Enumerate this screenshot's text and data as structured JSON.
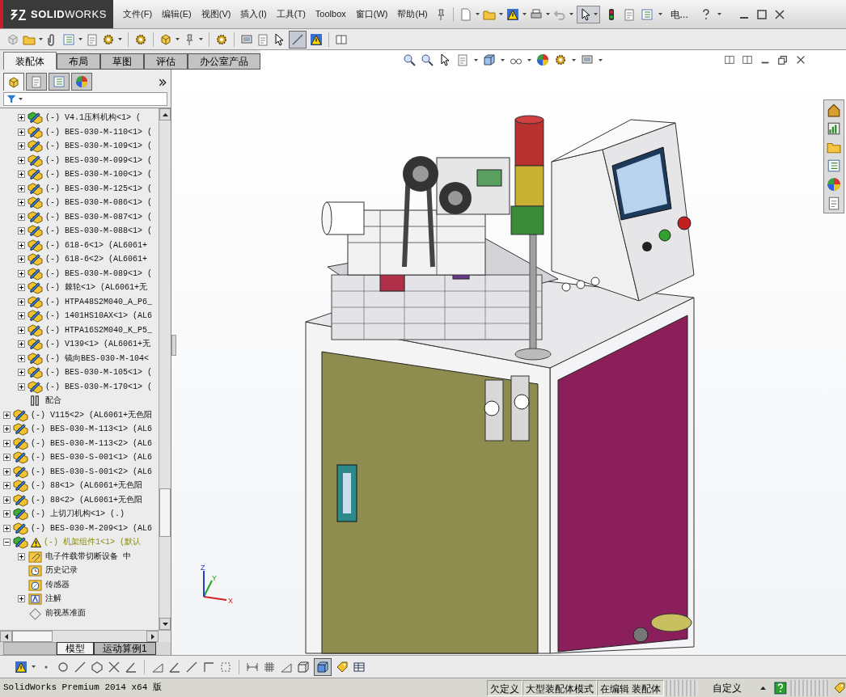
{
  "title_bar": {
    "logo": "**SOLID**WORKS",
    "menu": [
      "文件(F)",
      "编辑(E)",
      "视图(V)",
      "插入(I)",
      "工具(T)",
      "Toolbox",
      "窗口(W)",
      "帮助(H)"
    ],
    "document_name": "电..."
  },
  "command_tabs": [
    {
      "label": "装配体",
      "selected": true
    },
    {
      "label": "布局",
      "selected": false
    },
    {
      "label": "草图",
      "selected": false
    },
    {
      "label": "评估",
      "selected": false
    },
    {
      "label": "办公室产品",
      "selected": false
    }
  ],
  "panel_tabs": [
    {
      "selected": true
    },
    {
      "selected": false
    },
    {
      "selected": false
    },
    {
      "selected": false
    }
  ],
  "tree": {
    "continued_children": [
      {
        "label": "(-) V4.1压料机构<1> (",
        "kind": "assembly-active",
        "expandable": true,
        "expanded": false
      },
      {
        "label": "(-) BES-030-M-110<1> (",
        "kind": "assembly",
        "expandable": true,
        "expanded": false
      },
      {
        "label": "(-) BES-030-M-109<1> (",
        "kind": "assembly",
        "expandable": true,
        "expanded": false
      },
      {
        "label": "(-) BES-030-M-099<1> (",
        "kind": "assembly",
        "expandable": true,
        "expanded": false
      },
      {
        "label": "(-) BES-030-M-100<1> (",
        "kind": "assembly",
        "expandable": true,
        "expanded": false
      },
      {
        "label": "(-) BES-030-M-125<1> (",
        "kind": "assembly",
        "expandable": true,
        "expanded": false
      },
      {
        "label": "(-) BES-030-M-086<1> (",
        "kind": "assembly",
        "expandable": true,
        "expanded": false
      },
      {
        "label": "(-) BES-030-M-087<1> (",
        "kind": "assembly",
        "expandable": true,
        "expanded": false
      },
      {
        "label": "(-) BES-030-M-088<1> (",
        "kind": "assembly",
        "expandable": true,
        "expanded": false
      },
      {
        "label": "(-) 618-6<1> (AL6061+",
        "kind": "assembly",
        "expandable": true,
        "expanded": false
      },
      {
        "label": "(-) 618-6<2> (AL6061+",
        "kind": "assembly",
        "expandable": true,
        "expanded": false
      },
      {
        "label": "(-) BES-030-M-089<1> (",
        "kind": "assembly",
        "expandable": true,
        "expanded": false
      },
      {
        "label": "(-) 棘轮<1> (AL6061+无",
        "kind": "assembly",
        "expandable": true,
        "expanded": false
      },
      {
        "label": "(-) HTPA48S2M040_A_P6_",
        "kind": "assembly",
        "expandable": true,
        "expanded": false
      },
      {
        "label": "(-) 1401HS10AX<1> (AL6",
        "kind": "assembly",
        "expandable": true,
        "expanded": false
      },
      {
        "label": "(-) HTPA16S2M040_K_P5_",
        "kind": "assembly",
        "expandable": true,
        "expanded": false
      },
      {
        "label": "(-) V139<1> (AL6061+无",
        "kind": "assembly",
        "expandable": true,
        "expanded": false
      },
      {
        "label": "(-) 镜向BES-030-M-104<",
        "kind": "assembly",
        "expandable": true,
        "expanded": false
      },
      {
        "label": "(-) BES-030-M-105<1> (",
        "kind": "assembly",
        "expandable": true,
        "expanded": false
      },
      {
        "label": "(-) BES-030-M-170<1> (",
        "kind": "assembly",
        "expandable": true,
        "expanded": false
      },
      {
        "label": "配合",
        "kind": "mates",
        "expandable": false
      }
    ],
    "items": [
      {
        "label": "(-) V115<2> (AL6061+无色阳",
        "kind": "assembly",
        "expandable": true,
        "expanded": false,
        "warning": false
      },
      {
        "label": "(-) BES-030-M-113<1> (AL6",
        "kind": "assembly",
        "expandable": true,
        "expanded": false,
        "warning": false
      },
      {
        "label": "(-) BES-030-M-113<2> (AL6",
        "kind": "assembly",
        "expandable": true,
        "expanded": false,
        "warning": false
      },
      {
        "label": "(-) BES-030-S-001<1> (AL6",
        "kind": "assembly",
        "expandable": true,
        "expanded": false,
        "warning": false
      },
      {
        "label": "(-) BES-030-S-001<2> (AL6",
        "kind": "assembly",
        "expandable": true,
        "expanded": false,
        "warning": false
      },
      {
        "label": "(-) 88<1> (AL6061+无色阳",
        "kind": "assembly",
        "expandable": true,
        "expanded": false,
        "warning": false
      },
      {
        "label": "(-) 88<2> (AL6061+无色阳",
        "kind": "assembly",
        "expandable": true,
        "expanded": false,
        "warning": false
      },
      {
        "label": "(-) 上切刀机构<1> (.)",
        "kind": "assembly-active",
        "expandable": true,
        "expanded": false,
        "warning": false
      },
      {
        "label": "(-) BES-030-M-209<1> (AL6",
        "kind": "assembly",
        "expandable": true,
        "expanded": false,
        "warning": false
      },
      {
        "label": "(-) 机架组件1<1> (默认",
        "kind": "assembly-active",
        "expandable": true,
        "expanded": true,
        "warning": true,
        "children": [
          {
            "label": "电子件载带切断设备 中",
            "kind": "folder",
            "expandable": true,
            "expanded": false
          },
          {
            "label": "历史记录",
            "kind": "history",
            "expandable": false
          },
          {
            "label": "传感器",
            "kind": "sensor",
            "expandable": false
          },
          {
            "label": "注解",
            "kind": "annotations",
            "expandable": true,
            "expanded": false
          },
          {
            "label": "前视基准面",
            "kind": "plane",
            "expandable": false
          }
        ]
      }
    ]
  },
  "viewport": {
    "triad": {
      "x": "X",
      "y": "Y",
      "z": "Z"
    }
  },
  "bottom_tabs": [
    {
      "label": "模型",
      "selected": true
    },
    {
      "label": "运动算例1",
      "selected": false
    }
  ],
  "status_bar": {
    "product": "SolidWorks Premium 2014 x64 版",
    "fields": [
      "欠定义",
      "大型装配体模式",
      "在编辑 装配体"
    ],
    "units": "自定义"
  }
}
